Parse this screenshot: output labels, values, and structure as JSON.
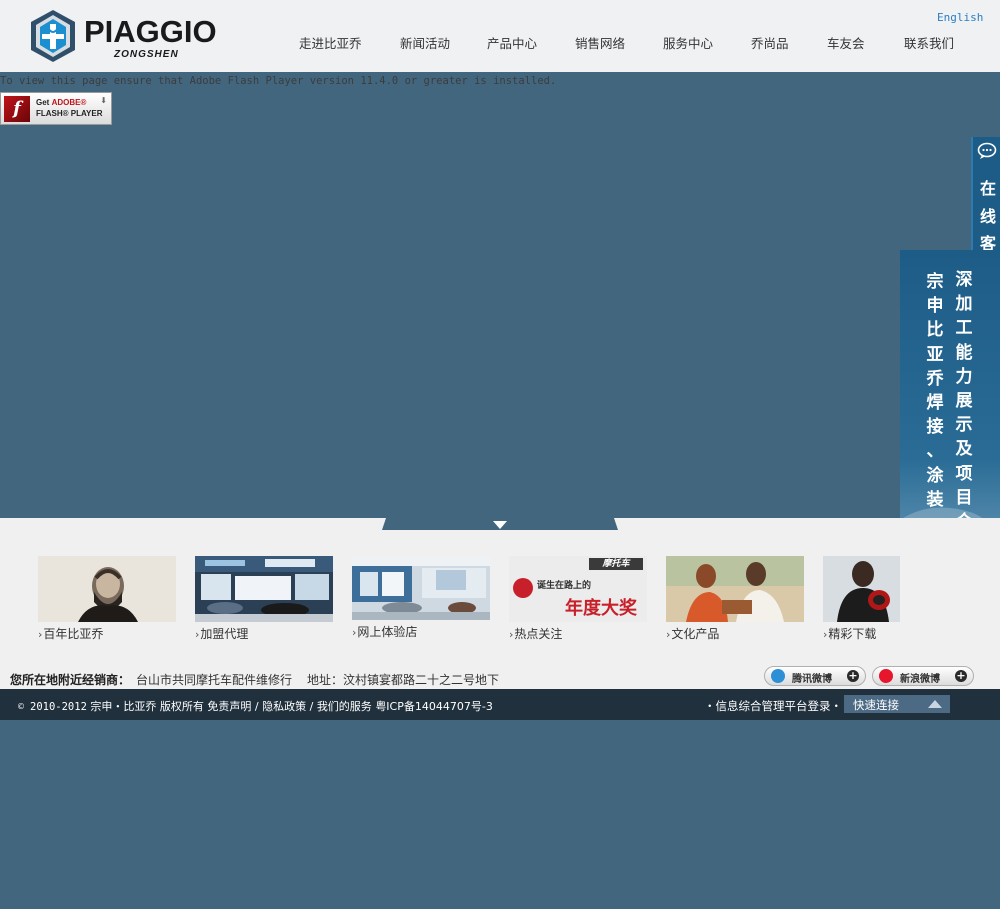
{
  "header": {
    "logo_text": "PIAGGIO",
    "logo_sub": "ZONGSHEN",
    "lang_link": "English",
    "nav": [
      "走进比亚乔",
      "新闻活动",
      "产品中心",
      "销售网络",
      "服务中心",
      "乔尚品",
      "车友会",
      "联系我们"
    ]
  },
  "flash": {
    "message": "To view this page ensure that Adobe Flash Player version 11.4.0 or greater is installed.",
    "button_line1_a": "Get ",
    "button_line1_b": "ADOBE®",
    "button_line2": "FLASH® PLAYER"
  },
  "thumbnails": [
    {
      "label": "百年比亚乔",
      "icon": "portrait-photo"
    },
    {
      "label": "加盟代理",
      "icon": "showroom-photo"
    },
    {
      "label": "网上体验店",
      "icon": "store-photo"
    },
    {
      "label": "热点关注",
      "icon": "award-banner"
    },
    {
      "label": "文化产品",
      "icon": "couple-photo"
    },
    {
      "label": "精彩下载",
      "icon": "rider-photo"
    }
  ],
  "award_banner": {
    "top": "摩托车",
    "small": "诞生在路上的",
    "big": "年度大奖"
  },
  "dealer": {
    "label": "您所在地附近经销商：",
    "name": "台山市共同摩托车配件维修行",
    "address_label": "地址：",
    "address": "汶村镇宴都路二十之二号地下"
  },
  "weibo": [
    {
      "label": "腾讯微博",
      "icon": "tencent-weibo-icon"
    },
    {
      "label": "新浪微博",
      "icon": "sina-weibo-icon"
    }
  ],
  "footer": {
    "years": "2010-2012",
    "brand": "宗申・比亚乔",
    "rights": "版权所有",
    "disclaimer": "免责声明",
    "privacy": "隐私政策",
    "services": "我们的服务",
    "icp": "粤ICP备14044707号-3",
    "platform_login": "・信息综合管理平台登录・",
    "quick_links": "快速连接"
  },
  "side_banner": {
    "col_right": "深加工能力展示及项目合作",
    "col_left": "宗申比亚乔焊接、涂装、注塑"
  },
  "service_tab": {
    "text": "在线客服"
  },
  "colors": {
    "page_bg": "#43667f",
    "header_bg": "#eff1f3",
    "footer_bg": "#20303d",
    "side_blue": "#1d5c87",
    "link_blue": "#2a7ec4"
  }
}
